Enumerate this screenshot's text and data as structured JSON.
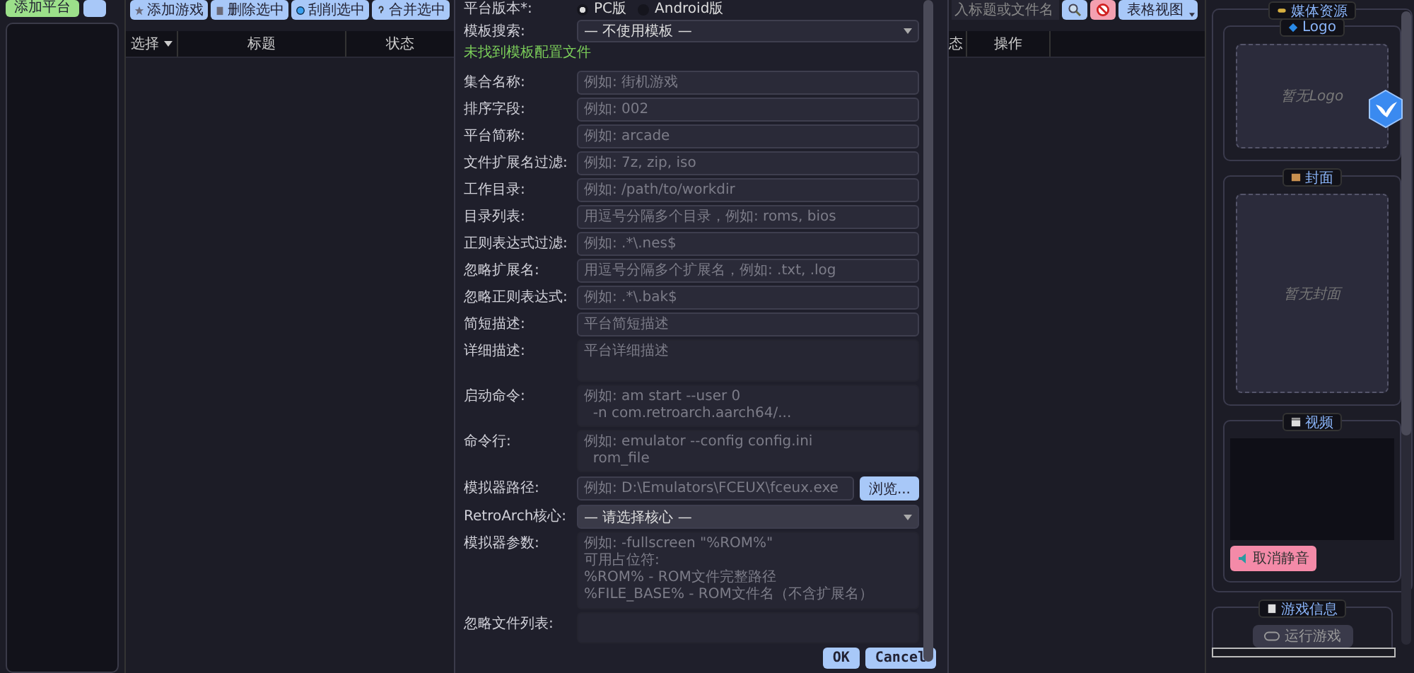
{
  "sidebar": {
    "add_button": "添加平台"
  },
  "toolbar": {
    "buttons": [
      {
        "label": "添加游戏",
        "kind": "add"
      },
      {
        "label": "删除选中",
        "kind": "delete"
      },
      {
        "label": "刮削选中",
        "kind": "scrape"
      },
      {
        "label": "合并选中",
        "kind": "merge"
      }
    ],
    "search": {
      "placeholder": "入标题或文件名"
    },
    "view_button": "表格视图"
  },
  "table": {
    "columns_left": [
      "选择",
      "标题",
      "状态"
    ],
    "columns_right": [
      "态",
      "操作"
    ]
  },
  "dialog": {
    "platform_version": {
      "label": "平台版本*:",
      "options": [
        {
          "label": "PC版",
          "selected": true
        },
        {
          "label": "Android版",
          "selected": false
        }
      ]
    },
    "template": {
      "label": "模板搜索:",
      "value": "— 不使用模板 —",
      "hint": "未找到模板配置文件"
    },
    "fields": [
      {
        "kind": "input",
        "label": "集合名称:",
        "placeholder": "例如: 街机游戏"
      },
      {
        "kind": "input",
        "label": "排序字段:",
        "placeholder": "例如: 002"
      },
      {
        "kind": "input",
        "label": "平台简称:",
        "placeholder": "例如: arcade"
      },
      {
        "kind": "input",
        "label": "文件扩展名过滤:",
        "placeholder": "例如: 7z, zip, iso"
      },
      {
        "kind": "input",
        "label": "工作目录:",
        "placeholder": "例如: /path/to/workdir"
      },
      {
        "kind": "input",
        "label": "目录列表:",
        "placeholder": "用逗号分隔多个目录，例如: roms, bios"
      },
      {
        "kind": "input",
        "label": "正则表达式过滤:",
        "placeholder": "例如: .*\\.nes$"
      },
      {
        "kind": "input",
        "label": "忽略扩展名:",
        "placeholder": "用逗号分隔多个扩展名，例如: .txt, .log"
      },
      {
        "kind": "input",
        "label": "忽略正则表达式:",
        "placeholder": "例如: .*\\.bak$"
      },
      {
        "kind": "input",
        "label": "简短描述:",
        "placeholder": "平台简短描述"
      },
      {
        "kind": "textarea",
        "label": "详细描述:",
        "placeholder": "平台详细描述"
      },
      {
        "kind": "textarea",
        "label": "启动命令:",
        "placeholder": "例如: am start --user 0\n  -n com.retroarch.aarch64/..."
      },
      {
        "kind": "textarea",
        "label": "命令行:",
        "placeholder": "例如: emulator --config config.ini\n  rom_file"
      },
      {
        "kind": "path",
        "label": "模拟器路径:",
        "placeholder": "例如: D:\\Emulators\\FCEUX\\fceux.exe",
        "button": "浏览..."
      },
      {
        "kind": "select",
        "label": "RetroArch核心:",
        "value": "— 请选择核心 —"
      },
      {
        "kind": "textarea",
        "label": "模拟器参数:",
        "placeholder": "例如: -fullscreen \"%ROM%\"\n可用占位符:\n%ROM% - ROM文件完整路径\n%FILE_BASE% - ROM文件名（不含扩展名）"
      },
      {
        "kind": "short",
        "label": "忽略文件列表:"
      }
    ],
    "buttons": [
      "OK",
      "Cancel"
    ]
  },
  "media_panel": {
    "title": "媒体资源",
    "sections": [
      {
        "kind": "image",
        "title": "Logo",
        "empty": "暂无Logo"
      },
      {
        "kind": "image",
        "title": "封面",
        "empty": "暂无封面"
      },
      {
        "kind": "video",
        "title": "视频",
        "button": "取消静音"
      }
    ]
  },
  "game_info": {
    "title": "游戏信息",
    "button": "运行游戏"
  }
}
